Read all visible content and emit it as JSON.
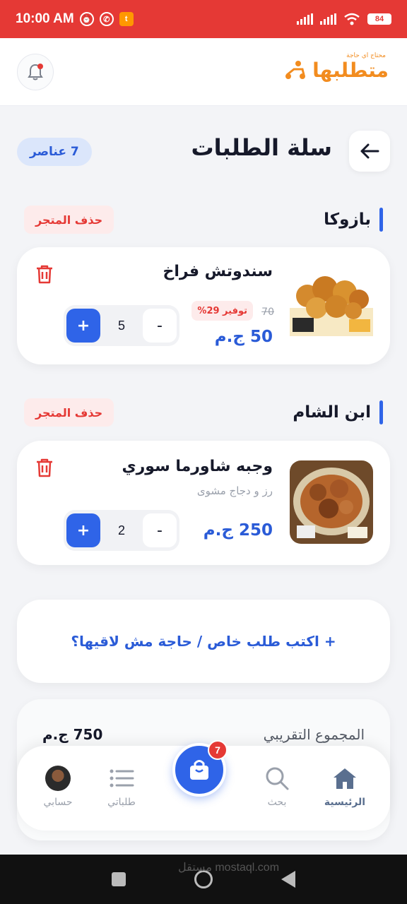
{
  "status_bar": {
    "time": "10:00 AM",
    "battery": "84"
  },
  "header": {
    "logo_tagline": "محتاج اي حاجة",
    "logo_name": "متطلبها"
  },
  "page": {
    "title": "سلة الطلبات",
    "item_count": "7 عناصر"
  },
  "stores": [
    {
      "name": "بازوكا",
      "delete_label": "حذف المتجر",
      "item": {
        "name": "سندوتش فراخ",
        "old_price": "70",
        "discount": "توفير 29%",
        "price": "50 ج.م",
        "quantity": "5",
        "plus": "+",
        "minus": "-"
      }
    },
    {
      "name": "ابن الشام",
      "delete_label": "حذف المتجر",
      "item": {
        "name": "وجبه شاورما سوري",
        "description": "رز و دجاج مشوى",
        "price": "250 ج.م",
        "quantity": "2",
        "plus": "+",
        "minus": "-"
      }
    }
  ],
  "special_request": "+ اكتب طلب خاص / حاجة مش لاقيها؟",
  "summary": {
    "label": "المجموع التقريبي",
    "value": "750 ج.م"
  },
  "bottom_nav": {
    "home": "الرئيسية",
    "search": "بحث",
    "orders": "طلباتي",
    "account": "حسابي",
    "cart_badge": "7"
  },
  "watermark": "مستقل mostaql.com",
  "colors": {
    "accent": "#2f64e8",
    "danger": "#e53935",
    "brand": "#f28c1f"
  }
}
